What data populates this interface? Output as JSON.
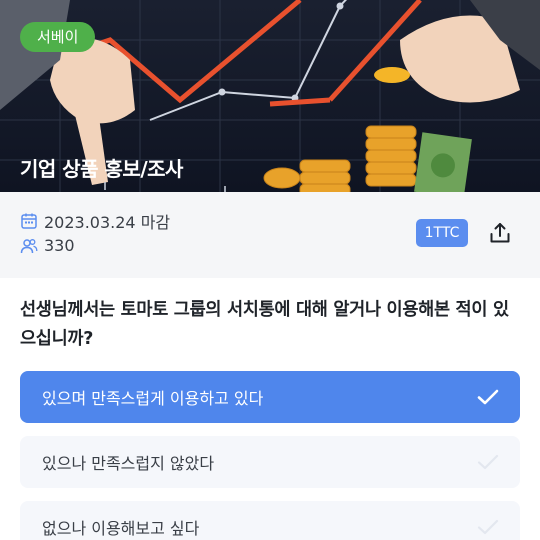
{
  "hero": {
    "tag": "서베이",
    "title": "기업 상품 홍보/조사"
  },
  "info": {
    "deadline": "2023.03.24 마감",
    "participants": "330",
    "token_label": "1TTC",
    "calendar_icon": "calendar-icon",
    "people_icon": "people-icon",
    "share_icon": "share-icon"
  },
  "question": {
    "text": "선생님께서는 토마토 그룹의 서치통에 대해 알거나 이용해본 적이 있으십니까?"
  },
  "options": [
    {
      "label": "있으며 만족스럽게 이용하고 있다",
      "selected": true
    },
    {
      "label": "있으나 만족스럽지 않았다",
      "selected": false
    },
    {
      "label": "없으나 이용해보고 싶다",
      "selected": false
    }
  ],
  "colors": {
    "accent": "#4f86ec",
    "tag": "#4fb04a",
    "badge": "#5b8def"
  }
}
